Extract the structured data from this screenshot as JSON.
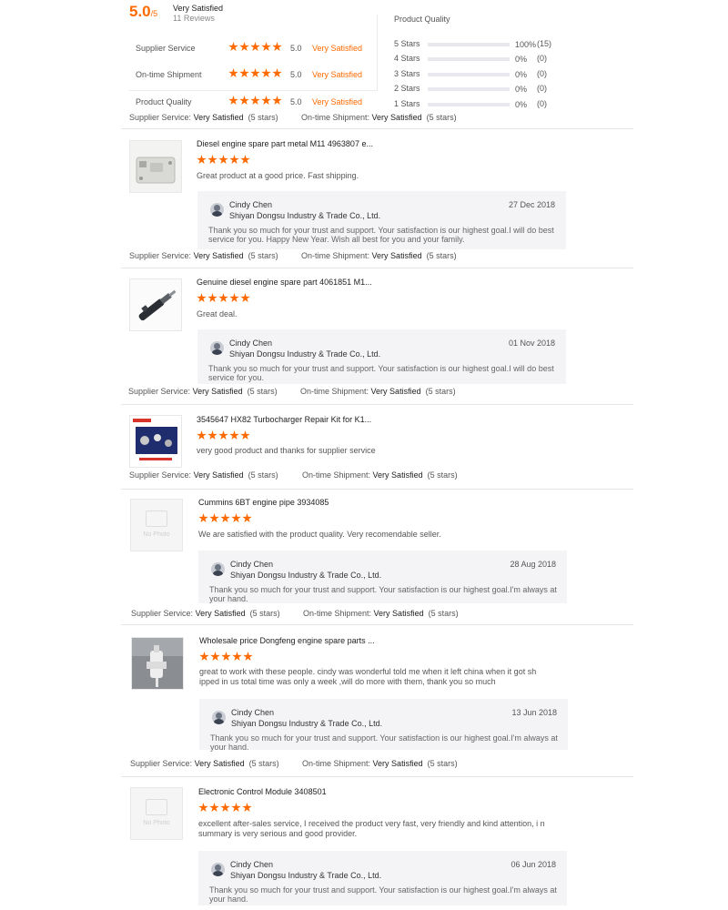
{
  "summary": {
    "score": "5.0",
    "score_max": "/5",
    "label": "Very Satisfied",
    "reviews": "11 Reviews",
    "dimensions": [
      {
        "name": "Supplier Service",
        "rating": 5,
        "score": "5.0",
        "word": "Very Satisfied"
      },
      {
        "name": "On-time Shipment",
        "rating": 5,
        "score": "5.0",
        "word": "Very Satisfied"
      },
      {
        "name": "Product Quality",
        "rating": 5,
        "score": "5.0",
        "word": "Very Satisfied"
      }
    ],
    "distribution": {
      "title": "Product Quality",
      "rows": [
        {
          "label": "5 Stars",
          "percent": "100%",
          "count": "(15)",
          "fill": 1.0
        },
        {
          "label": "4 Stars",
          "percent": "0%",
          "count": "(0)",
          "fill": 0
        },
        {
          "label": "3 Stars",
          "percent": "0%",
          "count": "(0)",
          "fill": 0
        },
        {
          "label": "2 Stars",
          "percent": "0%",
          "count": "(0)",
          "fill": 0
        },
        {
          "label": "1 Stars",
          "percent": "0%",
          "count": "(0)",
          "fill": 0
        }
      ]
    }
  },
  "labels": {
    "supplier_service": "Supplier Service:",
    "ontime_shipment": "On-time Shipment:",
    "very_satisfied": "Very Satisfied",
    "five_stars": "(5 stars)",
    "no_photo": "No Photo"
  },
  "reply_author": {
    "name": "Cindy Chen",
    "company": "Shiyan Dongsu Industry & Trade Co., Ltd."
  },
  "reviews": [
    {
      "title": "Diesel engine spare part metal M11 4963807 e...",
      "rating": 5,
      "text": "Great product at a good price. Fast shipping.",
      "reply_date": "27 Dec 2018",
      "reply_text": "Thank you so much for your trust and support. Your satisfaction is our highest goal.I will do best service for you. Happy New Year. Wish all best for you and your family.",
      "image": "engine-module"
    },
    {
      "title": "Genuine diesel engine spare part 4061851 M1...",
      "rating": 5,
      "text": "Great deal.",
      "reply_date": "01 Nov 2018",
      "reply_text": "Thank you so much for your trust and support. Your satisfaction is our highest goal.I will do best service for you.",
      "image": "injector"
    },
    {
      "title": "3545647 HX82 Turbocharger Repair Kit for K1...",
      "rating": 5,
      "text": "very good product and thanks for supplier service",
      "image": "repair-kit"
    },
    {
      "title": "Cummins 6BT engine pipe 3934085",
      "rating": 5,
      "text": "We are satisfied with the product quality. Very recomendable seller.",
      "reply_date": "28 Aug 2018",
      "reply_text": "Thank you so much for your trust and support. Your satisfaction is our highest goal.I'm always at your hand.",
      "image": "no-photo"
    },
    {
      "title": "Wholesale price Dongfeng engine spare parts ...",
      "rating": 5,
      "text": "great to work with these people. cindy was wonderful told me when it left china when it got sh ipped in us total time was only a week ,will do more with them, thank you so much",
      "reply_date": "13 Jun 2018",
      "reply_text": "Thank you so much for your trust and support. Your satisfaction is our highest goal.I'm always at your hand.",
      "image": "pump-part"
    },
    {
      "title": "Electronic Control Module 3408501",
      "rating": 5,
      "text": "excellent after-sales service, I received the product very fast, very friendly and kind attention, i n summary is very serious and good provider.",
      "reply_date": "06 Jun 2018",
      "reply_text": "Thank you so much for your trust and support. Your satisfaction is our highest goal.I'm always at your hand.",
      "image": "no-photo"
    }
  ]
}
